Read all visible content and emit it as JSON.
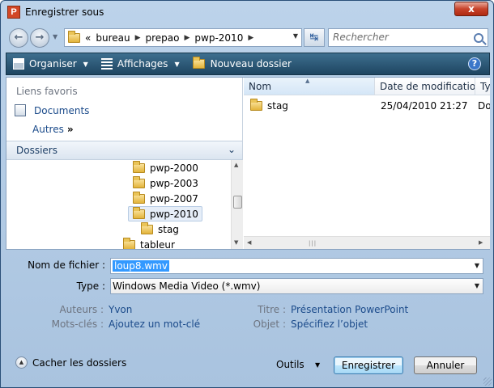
{
  "window": {
    "app_icon_letter": "P",
    "title": "Enregistrer sous",
    "close_glyph": "x"
  },
  "address": {
    "back_glyph": "←",
    "forward_glyph": "→",
    "overflow": "«",
    "crumbs": [
      "bureau",
      "prepao",
      "pwp-2010"
    ],
    "separator": "▶",
    "refresh_glyph": "↹",
    "search_placeholder": "Rechercher"
  },
  "toolbar": {
    "organiser": "Organiser",
    "affichages": "Affichages",
    "nouveau_dossier": "Nouveau dossier",
    "help_glyph": "?"
  },
  "nav_pane": {
    "favorites_heading": "Liens favoris",
    "documents": "Documents",
    "more": "Autres",
    "more_glyph": "»",
    "folders_heading": "Dossiers",
    "folders_chevron": "⌄",
    "tree": [
      {
        "label": "pwp-2000"
      },
      {
        "label": "pwp-2003"
      },
      {
        "label": "pwp-2007"
      },
      {
        "label": "pwp-2010",
        "selected": true
      },
      {
        "label": "stag"
      },
      {
        "label": "tableur"
      }
    ]
  },
  "file_list": {
    "columns": [
      "Nom",
      "Date de modificatio...",
      "Ty"
    ],
    "sort_glyph": "▲",
    "rows": [
      {
        "name": "stag",
        "date": "25/04/2010 21:27",
        "type": "Do"
      }
    ]
  },
  "form": {
    "filename_label": "Nom de fichier :",
    "filename_value": "loup8.wmv",
    "type_label": "Type :",
    "type_value": "Windows Media Video (*.wmv)",
    "authors_label": "Auteurs :",
    "authors_value": "Yvon",
    "keywords_label": "Mots-clés :",
    "keywords_value": "Ajoutez un mot-clé",
    "title_label": "Titre :",
    "title_value": "Présentation PowerPoint",
    "subject_label": "Objet :",
    "subject_value": "Spécifiez l’objet"
  },
  "footer": {
    "hide_folders": "Cacher les dossiers",
    "tools": "Outils",
    "save": "Enregistrer",
    "cancel": "Annuler"
  },
  "colors": {
    "link": "#1a4a8a",
    "toolbar": "#2b5775",
    "selection": "#3399ff"
  }
}
